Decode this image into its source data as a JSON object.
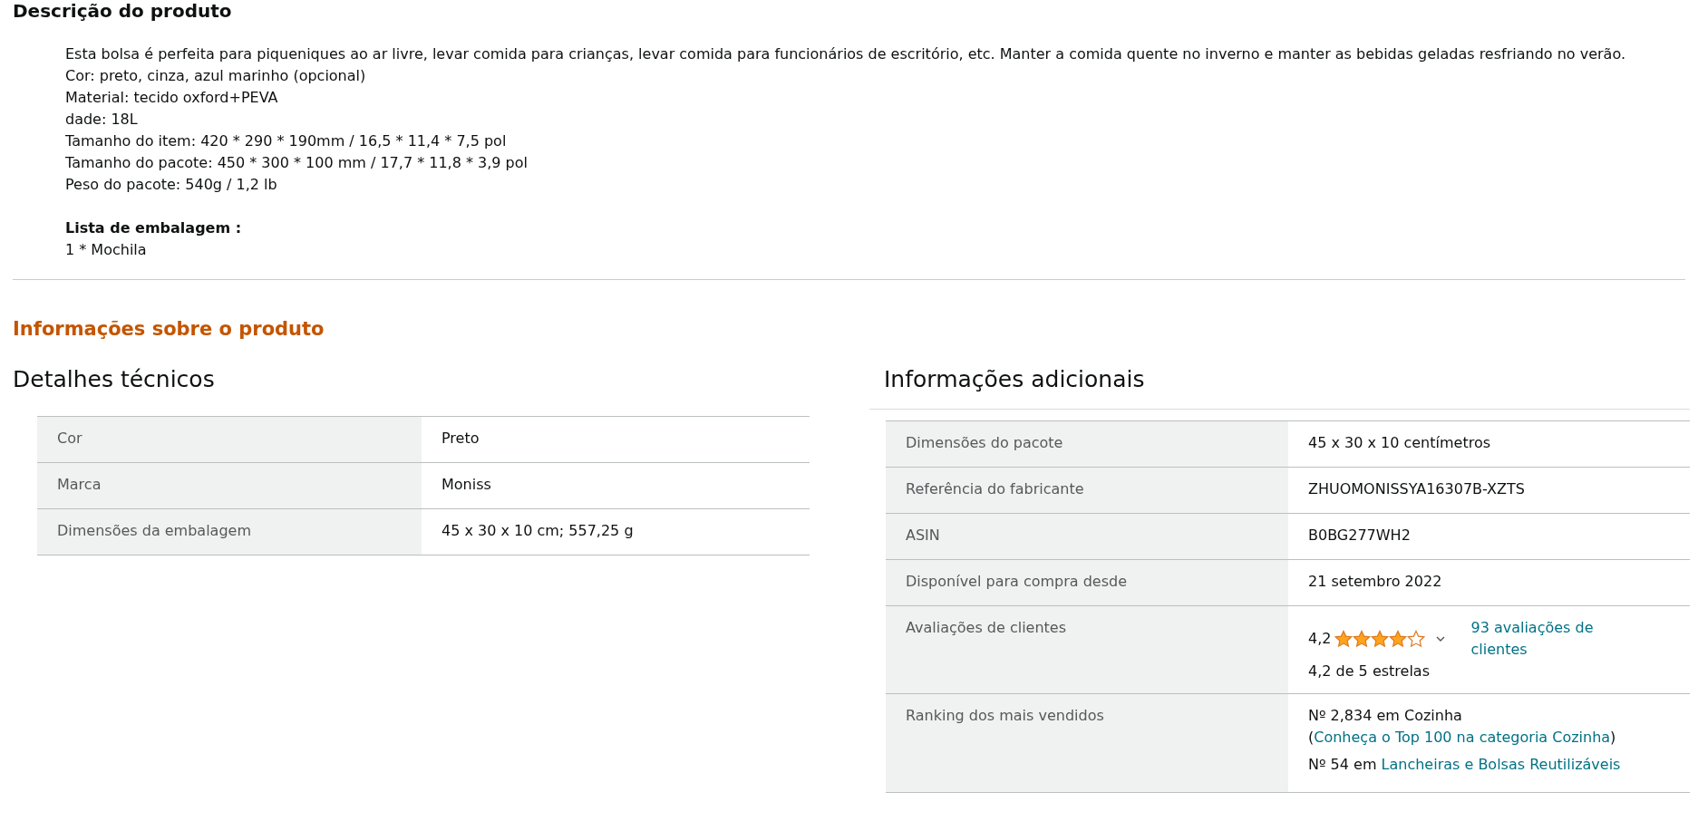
{
  "description": {
    "title": "Descrição do produto",
    "lines": [
      "Esta bolsa é perfeita para piqueniques ao ar livre, levar comida para crianças, levar comida para funcionários de escritório, etc. Manter a comida quente no inverno e manter as bebidas geladas resfriando no verão.",
      "Cor: preto, cinza, azul marinho (opcional)",
      "Material: tecido oxford+PEVA",
      "dade: 18L",
      "Tamanho do item: 420 * 290 * 190mm / 16,5 * 11,4 * 7,5 pol",
      "Tamanho do pacote: 450 * 300 * 100 mm / 17,7 * 11,8 * 3,9 pol",
      "Peso do pacote: 540g / 1,2 lb"
    ],
    "packing_title": "Lista de embalagem :",
    "packing_lines": [
      "1 * Mochila"
    ]
  },
  "info": {
    "title": "Informações sobre o produto"
  },
  "technical": {
    "title": "Detalhes técnicos",
    "rows": [
      {
        "label": "Cor",
        "value": "Preto"
      },
      {
        "label": "Marca",
        "value": "Moniss"
      },
      {
        "label": "Dimensões da embalagem",
        "value": "45 x 30 x 10 cm; 557,25 g"
      }
    ]
  },
  "additional": {
    "title": "Informações adicionais",
    "rows": [
      {
        "kind": "text",
        "label": "Dimensões do pacote",
        "value": "45 x 30 x 10 centímetros"
      },
      {
        "kind": "text",
        "label": "Referência do fabricante",
        "value": "ZHUOMONISSYA16307B-XZTS"
      },
      {
        "kind": "text",
        "label": "ASIN",
        "value": "B0BG277WH2"
      },
      {
        "kind": "text",
        "label": "Disponível para compra desde",
        "value": "21 setembro 2022"
      },
      {
        "kind": "rating",
        "label": "Avaliações de clientes",
        "rating": "4,2",
        "stars": 4,
        "link": "93 avaliações de clientes",
        "summary": "4,2 de 5 estrelas"
      },
      {
        "kind": "ranking",
        "label": "Ranking dos mais vendidos",
        "entries": [
          {
            "text": "Nº 2,834 em Cozinha (",
            "link": "Conheça o Top 100 na categoria Cozinha",
            "suffix": ")"
          },
          {
            "text": "Nº 54 em ",
            "link": "Lancheiras e Bolsas Reutilizáveis"
          }
        ]
      }
    ]
  }
}
